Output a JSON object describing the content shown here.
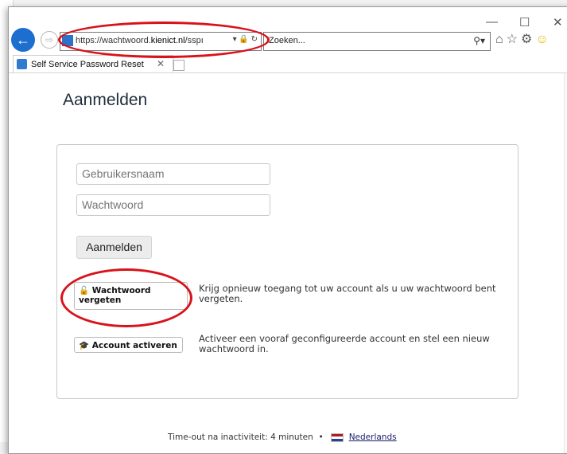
{
  "browser": {
    "back_icon": "arrow-left-icon",
    "forward_icon": "arrow-right-icon",
    "url_prefix": "https://wachtwoord.",
    "url_domain": "kienict.nl",
    "url_suffix": "/sspı",
    "search_placeholder": "Zoeken...",
    "tab_title": "Self Service Password Reset",
    "win_minimize": "—",
    "win_maximize": "☐",
    "win_close": "✕"
  },
  "page": {
    "title": "Aanmelden",
    "username_placeholder": "Gebruikersnaam",
    "password_placeholder": "Wachtwoord",
    "login_button": "Aanmelden",
    "forgot_button": "Wachtwoord vergeten",
    "forgot_description": "Krijg opnieuw toegang tot uw account als u uw wachtwoord bent vergeten.",
    "activate_button": "Account activeren",
    "activate_description": "Activeer een vooraf geconfigureerde account en stel een nieuw wachtwoord in.",
    "footer_timeout": "Time-out na inactiviteit: 4 minuten",
    "footer_bullet": "•",
    "footer_language": "Nederlands"
  },
  "colors": {
    "annotation": "#d8121a",
    "accent": "#1c6ecf"
  }
}
